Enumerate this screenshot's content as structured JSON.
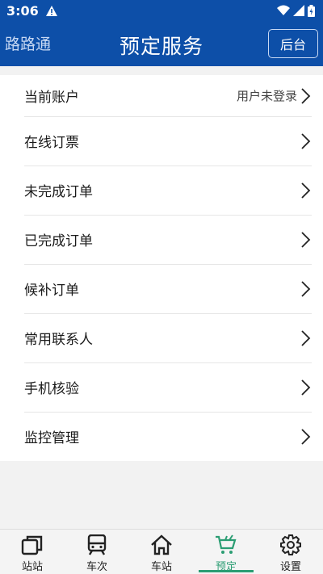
{
  "status_bar": {
    "time": "3:06"
  },
  "header": {
    "app_name": "路路通",
    "title": "预定服务",
    "admin_button": "后台"
  },
  "menu": [
    {
      "label": "当前账户",
      "value": "用户未登录"
    },
    {
      "label": "在线订票",
      "value": ""
    },
    {
      "label": "未完成订单",
      "value": ""
    },
    {
      "label": "已完成订单",
      "value": ""
    },
    {
      "label": "候补订单",
      "value": ""
    },
    {
      "label": "常用联系人",
      "value": ""
    },
    {
      "label": "手机核验",
      "value": ""
    },
    {
      "label": "监控管理",
      "value": ""
    }
  ],
  "tabs": [
    {
      "label": "站站",
      "icon": "copy-icon"
    },
    {
      "label": "车次",
      "icon": "train-icon"
    },
    {
      "label": "车站",
      "icon": "home-icon"
    },
    {
      "label": "预定",
      "icon": "cart-icon",
      "active": true
    },
    {
      "label": "设置",
      "icon": "gear-icon"
    }
  ],
  "colors": {
    "header": "#0d4fa8",
    "accent": "#2b9d73"
  }
}
